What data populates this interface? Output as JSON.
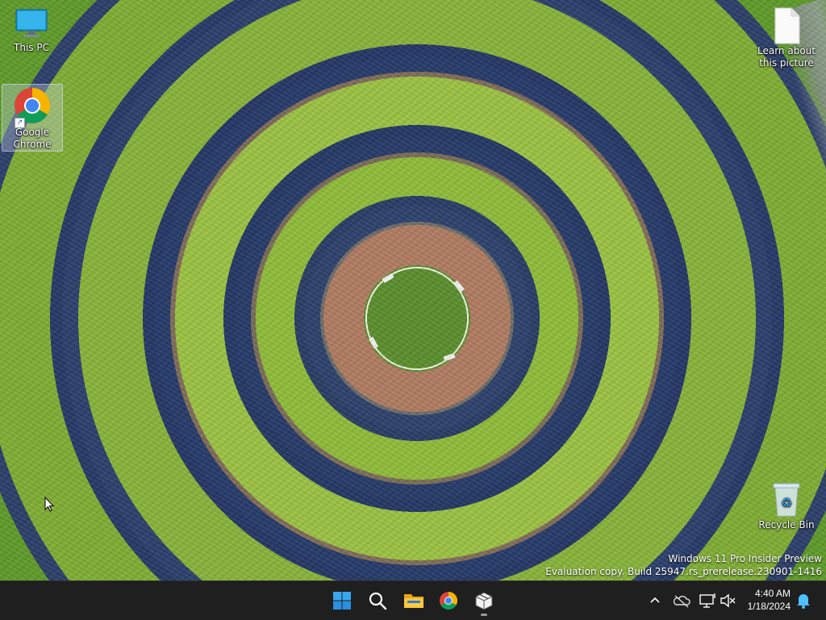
{
  "desktop": {
    "icons": [
      {
        "label": "This PC",
        "icon": "monitor-icon"
      },
      {
        "label": "Google Chrome",
        "label_line1": "Google",
        "label_line2": "Chrome",
        "icon": "chrome-icon"
      },
      {
        "label": "Learn about this picture",
        "label_line1": "Learn about",
        "label_line2": "this picture",
        "icon": "document-icon"
      },
      {
        "label": "Recycle Bin",
        "icon": "recycle-bin-icon"
      }
    ]
  },
  "watermark": {
    "line1": "Windows 11 Pro Insider Preview",
    "line2": "Evaluation copy. Build 25947.rs_prerelease.230901-1416"
  },
  "taskbar": {
    "pinned": [
      {
        "name": "Start",
        "icon": "windows-logo-icon"
      },
      {
        "name": "Search",
        "icon": "search-icon"
      },
      {
        "name": "File Explorer",
        "icon": "folder-icon"
      },
      {
        "name": "Google Chrome",
        "icon": "chrome-icon"
      },
      {
        "name": "Package",
        "icon": "package-icon",
        "running": true
      }
    ],
    "tray": {
      "icons": [
        "chevron-up-icon",
        "onedrive-off-icon",
        "network-icon",
        "volume-muted-icon",
        "notification-bell-icon"
      ],
      "time": "4:40 AM",
      "date": "1/18/2024"
    }
  },
  "colors": {
    "taskbar_bg": "#1f1f1f",
    "accent": "#0078d4",
    "notification": "#4cc2ff"
  }
}
